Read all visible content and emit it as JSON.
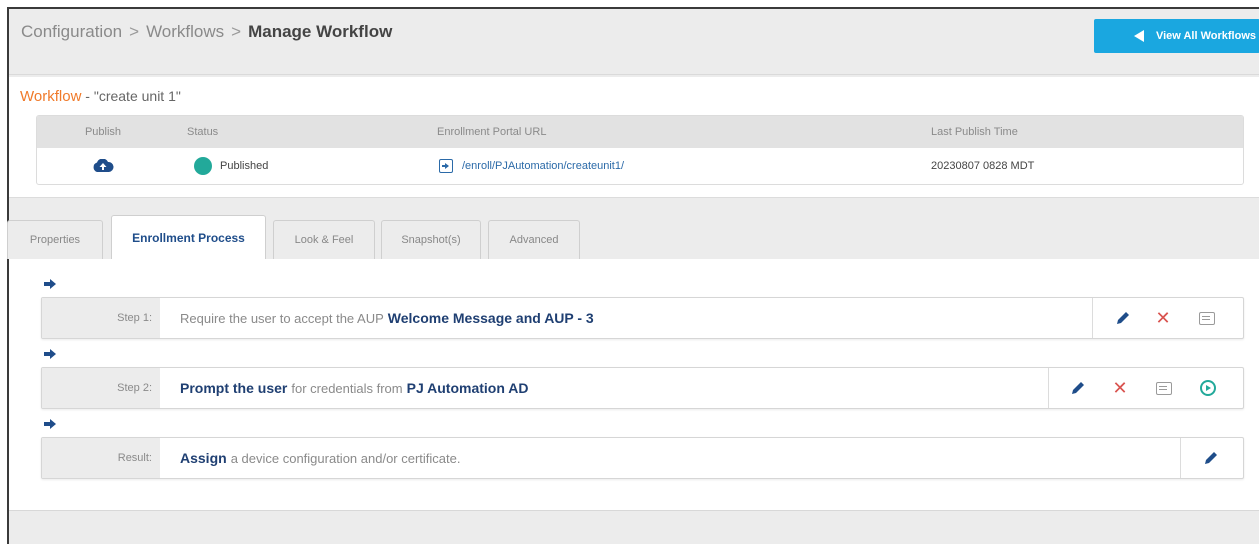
{
  "header": {
    "breadcrumb": [
      "Configuration",
      "Workflows",
      "Manage Workflow"
    ],
    "separator": ">",
    "view_all_button": "View All Workflows",
    "button_color": "#1aa7e0"
  },
  "workflow": {
    "label": "Workflow",
    "name_text": "- \"create unit 1\"",
    "columns": [
      "Publish",
      "Status",
      "Enrollment Portal URL",
      "Last Publish Time"
    ],
    "row": {
      "publish_icon": "cloud-upload-icon",
      "status": "Published",
      "status_color": "#22a99a",
      "url": "/enroll/PJAutomation/createunit1/",
      "last_publish_time": "20230807 0828 MDT"
    }
  },
  "tabs": [
    {
      "label": "Properties",
      "active": false
    },
    {
      "label": "Enrollment Process",
      "active": true
    },
    {
      "label": "Look & Feel",
      "active": false
    },
    {
      "label": "Snapshot(s)",
      "active": false
    },
    {
      "label": "Advanced",
      "active": false
    }
  ],
  "steps": [
    {
      "label": "Step 1:",
      "text_pre": "Require the user to accept the AUP",
      "bold_a": "Welcome Message and AUP - 3",
      "text_mid": "",
      "bold_b": "",
      "actions": [
        "pencil-icon",
        "delete-icon",
        "message-icon"
      ]
    },
    {
      "label": "Step 2:",
      "text_pre": "",
      "bold_a": "Prompt the user",
      "text_mid": "for credentials from",
      "bold_b": "PJ Automation AD",
      "actions": [
        "pencil-icon",
        "delete-icon",
        "message-icon",
        "play-icon"
      ]
    },
    {
      "label": "Result:",
      "text_pre": "",
      "bold_a": "Assign",
      "text_mid": "a device configuration and/or certificate.",
      "bold_b": "",
      "actions": [
        "pencil-icon"
      ]
    }
  ]
}
